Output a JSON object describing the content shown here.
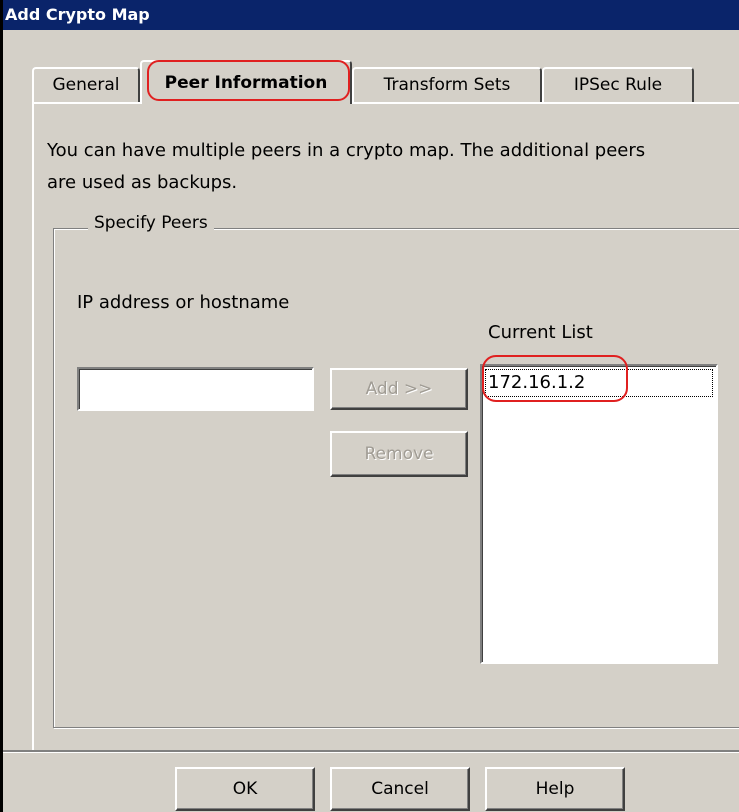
{
  "window": {
    "title": "Add Crypto Map"
  },
  "tabs": [
    {
      "label": "General"
    },
    {
      "label": "Peer Information"
    },
    {
      "label": "Transform Sets"
    },
    {
      "label": "IPSec Rule"
    }
  ],
  "description": {
    "line1": "You can have multiple peers in a crypto map. The additional peers",
    "line2": "are used as backups."
  },
  "specify_peers": {
    "title": "Specify Peers",
    "ip_label": "IP address or hostname",
    "ip_value": "",
    "add_button": "Add >>",
    "remove_button": "Remove",
    "current_list_label": "Current List",
    "current_list": [
      "172.16.1.2"
    ]
  },
  "footer": {
    "ok": "OK",
    "cancel": "Cancel",
    "help": "Help"
  },
  "colors": {
    "titlebar": "#0a246a",
    "dialog_bg": "#d4d0c8",
    "highlight_ring": "#e02020"
  }
}
